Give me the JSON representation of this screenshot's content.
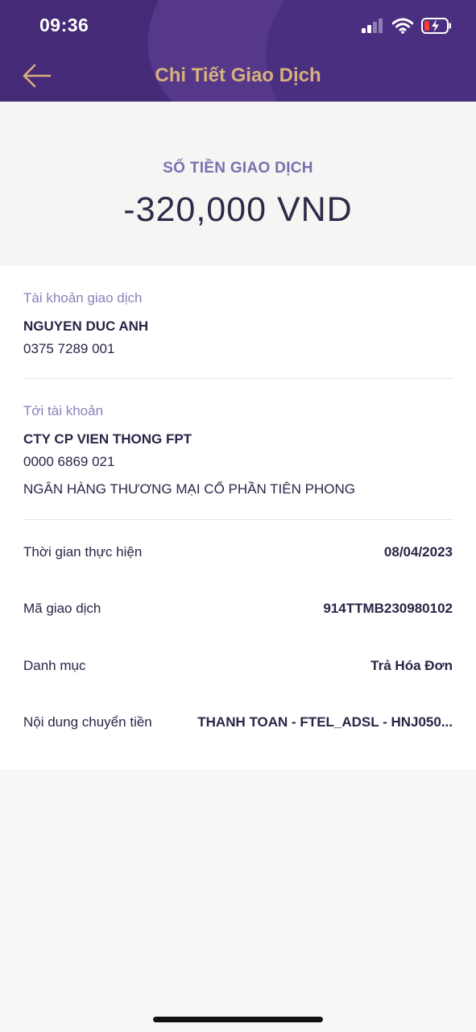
{
  "status_bar": {
    "time": "09:36"
  },
  "header": {
    "title": "Chi Tiết Giao Dịch"
  },
  "amount": {
    "label": "SỐ TIỀN GIAO DỊCH",
    "value": "-320,000 VND"
  },
  "from_account": {
    "label": "Tài khoản giao dịch",
    "name": "NGUYEN DUC ANH",
    "number": "0375 7289 001"
  },
  "to_account": {
    "label": "Tới tài khoản",
    "name": "CTY CP VIEN THONG FPT",
    "number": "0000 6869 021",
    "bank": "NGÂN HÀNG THƯƠNG MẠI CỔ PHẦN TIÊN PHONG"
  },
  "rows": [
    {
      "label": "Thời gian thực hiện",
      "value": "08/04/2023"
    },
    {
      "label": "Mã giao dịch",
      "value": "914TTMB230980102"
    },
    {
      "label": "Danh mục",
      "value": "Trả Hóa Đơn"
    },
    {
      "label": "Nội dung chuyển tiền",
      "value": "THANH TOAN - FTEL_ADSL - HNJ050..."
    }
  ],
  "colors": {
    "header_bg": "#452a78",
    "title": "#d7b07c",
    "accent_label": "#8c80b9"
  }
}
